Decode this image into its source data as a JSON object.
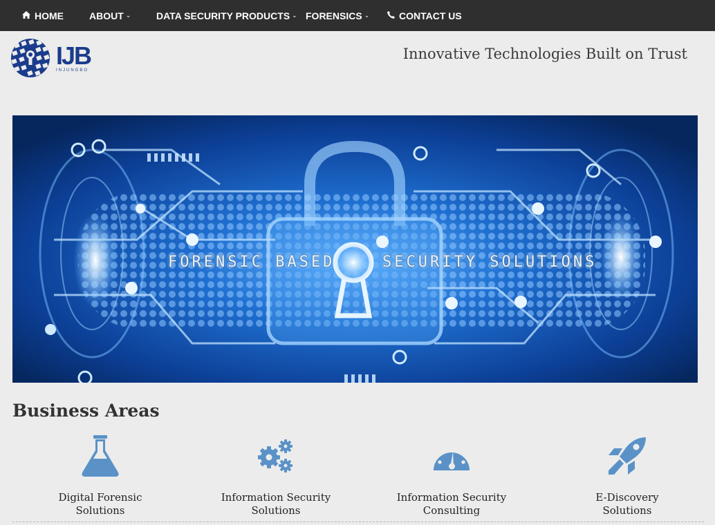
{
  "nav": {
    "items": [
      {
        "label": "HOME",
        "icon": "home-icon",
        "caret": false
      },
      {
        "label": "ABOUT",
        "icon": "",
        "caret": true
      },
      {
        "label": "DATA SECURITY PRODUCTS",
        "icon": "",
        "caret": true
      },
      {
        "label": "FORENSICS",
        "icon": "",
        "caret": true
      },
      {
        "label": "CONTACT US",
        "icon": "phone-icon",
        "caret": false
      }
    ]
  },
  "header": {
    "logo_text": "IJB",
    "logo_subtext": "INJUNGBO",
    "tagline": "Innovative Technologies Built on Trust"
  },
  "hero": {
    "text_left": "FORENSIC BASED",
    "text_right": "SECURITY SOLUTIONS"
  },
  "business": {
    "title": "Business Areas",
    "items": [
      {
        "line1": "Digital Forensic",
        "line2": "Solutions",
        "icon": "flask-icon"
      },
      {
        "line1": "Information Security",
        "line2": "Solutions",
        "icon": "gears-icon"
      },
      {
        "line1": "Information Security",
        "line2": "Consulting",
        "icon": "dashboard-icon"
      },
      {
        "line1": "E-Discovery",
        "line2": "Solutions",
        "icon": "rocket-icon"
      }
    ]
  },
  "colors": {
    "nav_bg": "#2f2f2f",
    "icon_blue": "#5a92c8",
    "brand_blue": "#1b3c8c",
    "page_bg": "#ececec"
  }
}
